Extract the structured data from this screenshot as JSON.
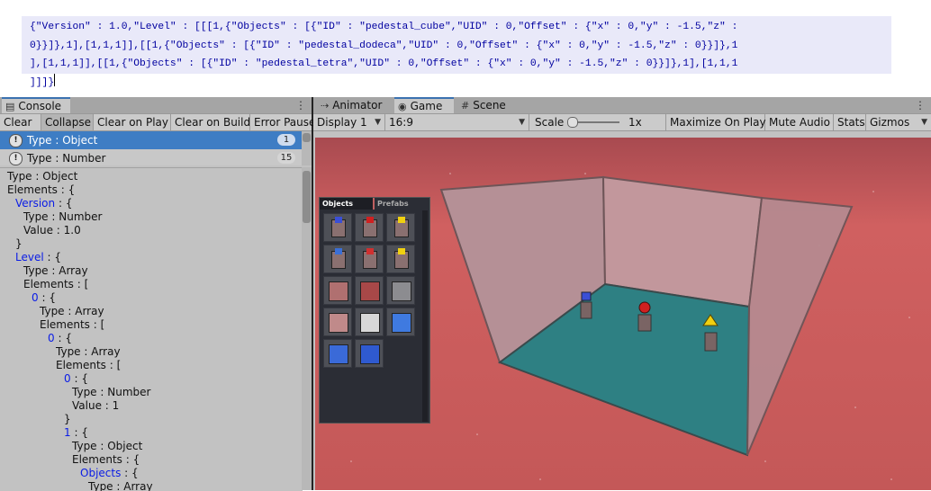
{
  "json_strip": {
    "lines": [
      "{\"Version\" : 1.0,\"Level\" : [[[1,{\"Objects\" : [{\"ID\" : \"pedestal_cube\",\"UID\" : 0,\"Offset\" : {\"x\" : 0,\"y\" : -1.5,\"z\" :",
      "0}}]},1],[1,1,1]],[[1,{\"Objects\" : [{\"ID\" : \"pedestal_dodeca\",\"UID\" : 0,\"Offset\" : {\"x\" : 0,\"y\" : -1.5,\"z\" : 0}}]},1",
      "],[1,1,1]],[[1,{\"Objects\" : [{\"ID\" : \"pedestal_tetra\",\"UID\" : 0,\"Offset\" : {\"x\" : 0,\"y\" : -1.5,\"z\" : 0}}]},1],[1,1,1",
      "]]]}"
    ]
  },
  "console": {
    "tab_label": "Console",
    "toolbar": [
      "Clear",
      "Collapse",
      "Clear on Play",
      "Clear on Build",
      "Error Pause"
    ],
    "toolbar_active": "Collapse",
    "entries": [
      {
        "text": "Type : Object",
        "count": "1",
        "selected": true
      },
      {
        "text": "Type : Number",
        "count": "15",
        "selected": false
      }
    ],
    "detail_lines": [
      {
        "text": "Type : Object",
        "indent": 0,
        "kw": false
      },
      {
        "text": "Elements : {",
        "indent": 0,
        "kw": false
      },
      {
        "text": "Version",
        "suffix": " : {",
        "indent": 1,
        "kw": true
      },
      {
        "text": "Type : Number",
        "indent": 2,
        "kw": false
      },
      {
        "text": "Value : 1.0",
        "indent": 2,
        "kw": false
      },
      {
        "text": "}",
        "indent": 1,
        "kw": false
      },
      {
        "text": "Level",
        "suffix": " : {",
        "indent": 1,
        "kw": true
      },
      {
        "text": "Type : Array",
        "indent": 2,
        "kw": false
      },
      {
        "text": "Elements : [",
        "indent": 2,
        "kw": false
      },
      {
        "text": "0",
        "suffix": " : {",
        "indent": 3,
        "kw": true
      },
      {
        "text": "Type : Array",
        "indent": 4,
        "kw": false
      },
      {
        "text": "Elements : [",
        "indent": 4,
        "kw": false
      },
      {
        "text": "0",
        "suffix": " : {",
        "indent": 5,
        "kw": true
      },
      {
        "text": "Type : Array",
        "indent": 6,
        "kw": false
      },
      {
        "text": "Elements : [",
        "indent": 6,
        "kw": false
      },
      {
        "text": "0",
        "suffix": " : {",
        "indent": 7,
        "kw": true
      },
      {
        "text": "Type : Number",
        "indent": 8,
        "kw": false
      },
      {
        "text": "Value : 1",
        "indent": 8,
        "kw": false
      },
      {
        "text": "}",
        "indent": 7,
        "kw": false
      },
      {
        "text": "1",
        "suffix": " : {",
        "indent": 7,
        "kw": true
      },
      {
        "text": "Type : Object",
        "indent": 8,
        "kw": false
      },
      {
        "text": "Elements : {",
        "indent": 8,
        "kw": false
      },
      {
        "text": "Objects",
        "suffix": " : {",
        "indent": 9,
        "kw": true
      },
      {
        "text": "Type : Array",
        "indent": 10,
        "kw": false
      }
    ]
  },
  "right_panel": {
    "tabs": [
      {
        "label": "Animator",
        "icon": "animator-icon"
      },
      {
        "label": "Game",
        "icon": "game-controller-icon",
        "active": true
      },
      {
        "label": "Scene",
        "icon": "scene-grid-icon"
      }
    ],
    "toolbar": {
      "display": "Display 1",
      "aspect": "16:9",
      "scale_label": "Scale",
      "scale_value": "1x",
      "maximize": "Maximize On Play",
      "mute": "Mute Audio",
      "stats": "Stats",
      "gizmos": "Gizmos"
    }
  },
  "palette": {
    "tabs": [
      "Objects",
      "Prefabs"
    ],
    "items": [
      "pedestal-cube-blue",
      "pedestal-dodeca-red",
      "pedestal-tetra-yellow",
      "block-blue-top",
      "block-red-top",
      "block-yellow-top",
      "panel-pink-1",
      "panel-pink-2",
      "panel-grey",
      "panel-pink-3",
      "panel-white-lines",
      "panel-blue-1",
      "panel-blue-2",
      "panel-blue-3"
    ]
  },
  "colors": {
    "sky": "#c85a5a",
    "floor": "#2f7f82",
    "wall": "#c89a9e",
    "selected_row": "#3e7dc4",
    "keyword": "#0a1ce6"
  }
}
